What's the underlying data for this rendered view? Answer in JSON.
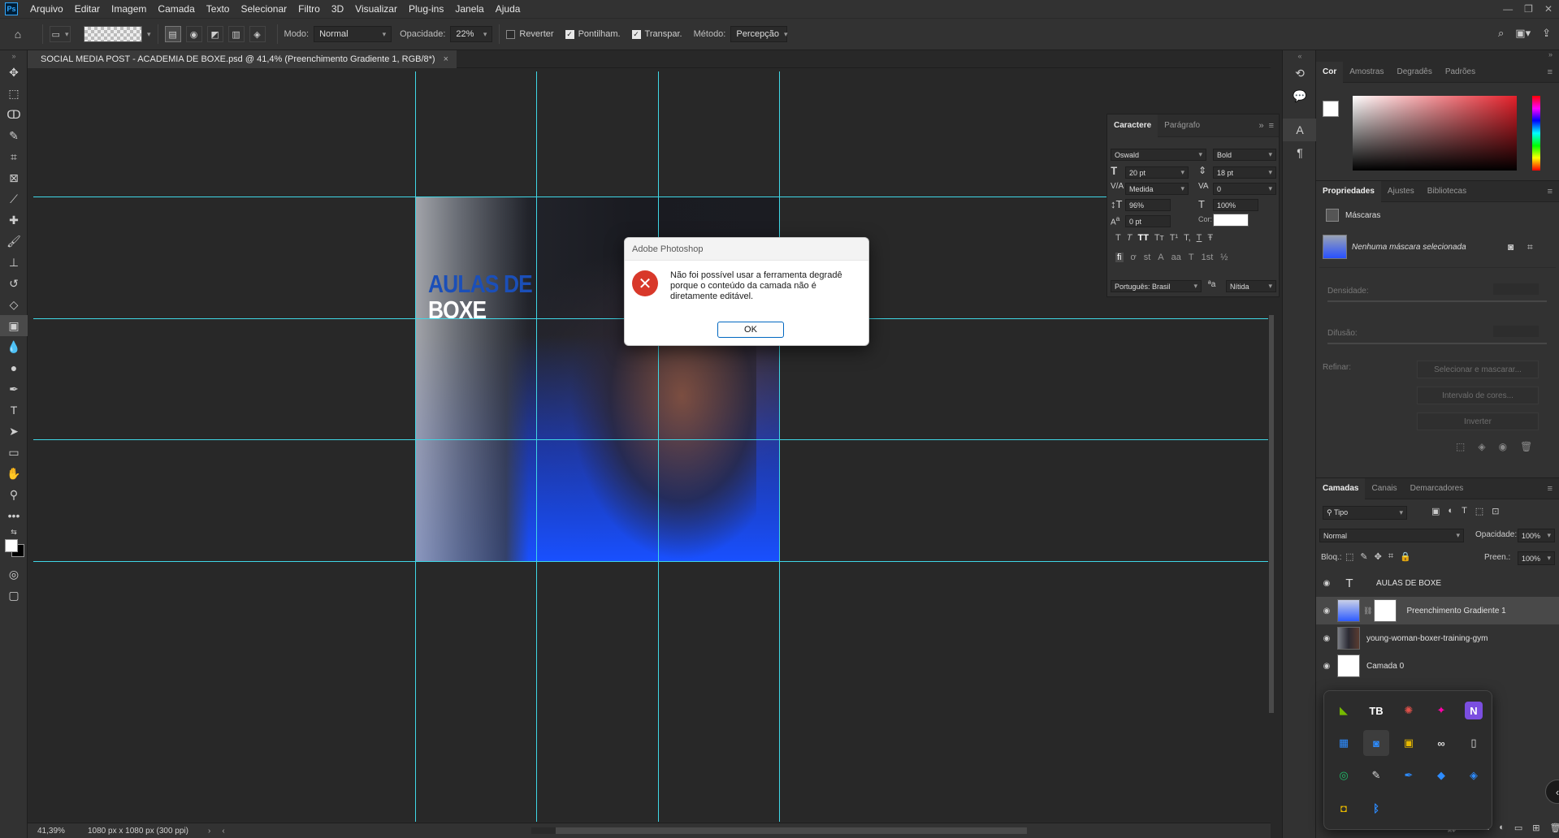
{
  "app": {
    "logo": "Ps",
    "menu": [
      "Arquivo",
      "Editar",
      "Imagem",
      "Camada",
      "Texto",
      "Selecionar",
      "Filtro",
      "3D",
      "Visualizar",
      "Plug-ins",
      "Janela",
      "Ajuda"
    ]
  },
  "options": {
    "mode_label": "Modo:",
    "mode_value": "Normal",
    "opacity_label": "Opacidade:",
    "opacity_value": "22%",
    "reverse_label": "Reverter",
    "dither_label": "Pontilham.",
    "transparency_label": "Transpar.",
    "method_label": "Método:",
    "method_value": "Percepção"
  },
  "document": {
    "tab_title": "SOCIAL MEDIA POST - ACADEMIA DE BOXE.psd @ 41,4% (Preenchimento Gradiente 1, RGB/8*)",
    "art_title_line1": "AULAS DE",
    "art_title_line2": "BOXE"
  },
  "status": {
    "zoom": "41,39%",
    "doc_info": "1080 px x 1080 px (300 ppi)"
  },
  "character_panel": {
    "tabs": [
      "Caractere",
      "Parágrafo"
    ],
    "font_family": "Oswald",
    "font_style": "Bold",
    "font_size": "20 pt",
    "leading": "18 pt",
    "kerning": "Medida",
    "tracking": "0",
    "vertical_scale": "96%",
    "horizontal_scale": "100%",
    "baseline_shift": "0 pt",
    "color_label": "Cor:",
    "language": "Português: Brasil",
    "antialias_label": "ªa",
    "antialias": "Nítida",
    "style_buttons": [
      "T",
      "T",
      "TT",
      "Tт",
      "T¹",
      "T,",
      "T",
      "Ŧ"
    ],
    "opentype_buttons": [
      "fi",
      "ơ",
      "st",
      "A",
      "aa",
      "T",
      "1st",
      "½"
    ]
  },
  "color_panel": {
    "tabs": [
      "Cor",
      "Amostras",
      "Degradês",
      "Padrões"
    ],
    "foreground": "#ffffff",
    "background": "#000000",
    "hue_color": "#e4202a"
  },
  "properties_panel": {
    "tabs": [
      "Propriedades",
      "Ajustes",
      "Bibliotecas"
    ],
    "section": "Máscaras",
    "mask_status": "Nenhuma máscara selecionada",
    "density_label": "Densidade:",
    "feather_label": "Difusão:",
    "refine_label": "Refinar:",
    "btn_select_mask": "Selecionar e mascarar...",
    "btn_color_range": "Intervalo de cores...",
    "btn_invert": "Inverter"
  },
  "layers_panel": {
    "tabs": [
      "Camadas",
      "Canais",
      "Demarcadores"
    ],
    "filter": "Tipo",
    "blend_mode": "Normal",
    "opacity_label": "Opacidade:",
    "opacity": "100%",
    "lock_label": "Bloq.:",
    "fill_label": "Preen.:",
    "fill": "100%",
    "layers": [
      {
        "name": "AULAS DE BOXE",
        "kind": "text"
      },
      {
        "name": "Preenchimento Gradiente 1",
        "kind": "gradient"
      },
      {
        "name": "young-woman-boxer-training-gym",
        "kind": "image"
      },
      {
        "name": "Camada 0",
        "kind": "image"
      }
    ]
  },
  "dialog": {
    "title": "Adobe Photoshop",
    "message": "Não foi possível usar a ferramenta degradê porque o conteúdo da camada não é diretamente editável.",
    "ok_label": "OK"
  },
  "tray": {
    "icons": [
      "nvidia-icon",
      "tb-icon",
      "color-wheel-icon",
      "dark-app-icon",
      "onenote-icon",
      "widgets-icon",
      "camera-icon",
      "image-app-icon",
      "link-icon",
      "usb-icon",
      "speaker-icon",
      "script-icon",
      "feather-icon",
      "drop-icon",
      "gem-icon",
      "camera-app-icon",
      "bluetooth-icon"
    ],
    "colors": {
      "accent": "#1ec06a",
      "blue": "#2d8cff",
      "purple": "#7b4ee0"
    }
  }
}
